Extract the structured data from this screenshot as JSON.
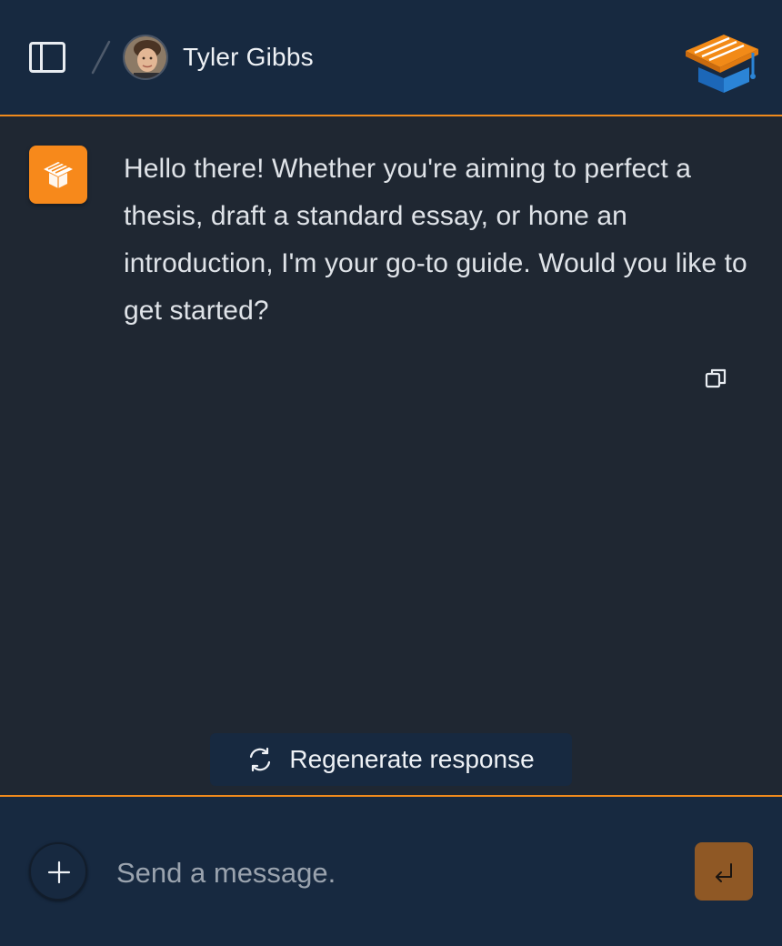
{
  "header": {
    "user_name": "Tyler Gibbs",
    "sidebar_icon": "sidebar-panel-icon",
    "avatar_icon": "user-avatar",
    "logo_icon": "graduation-cap-box-logo"
  },
  "chat": {
    "message": "Hello there! Whether you're aiming to perfect a thesis, draft a standard essay, or hone an introduction, I'm your go-to guide. Would you like to get started?",
    "bot_icon": "graduation-cap-box-icon",
    "copy_icon": "copy-icon"
  },
  "regenerate": {
    "label": "Regenerate response",
    "icon": "refresh-icon"
  },
  "composer": {
    "placeholder": "Send a message.",
    "value": "",
    "add_icon": "plus-icon",
    "send_icon": "enter-icon"
  },
  "colors": {
    "accent": "#f08a1c",
    "header_bg": "#172940",
    "chat_bg": "#1f2732",
    "send_bg": "#8f5825"
  }
}
